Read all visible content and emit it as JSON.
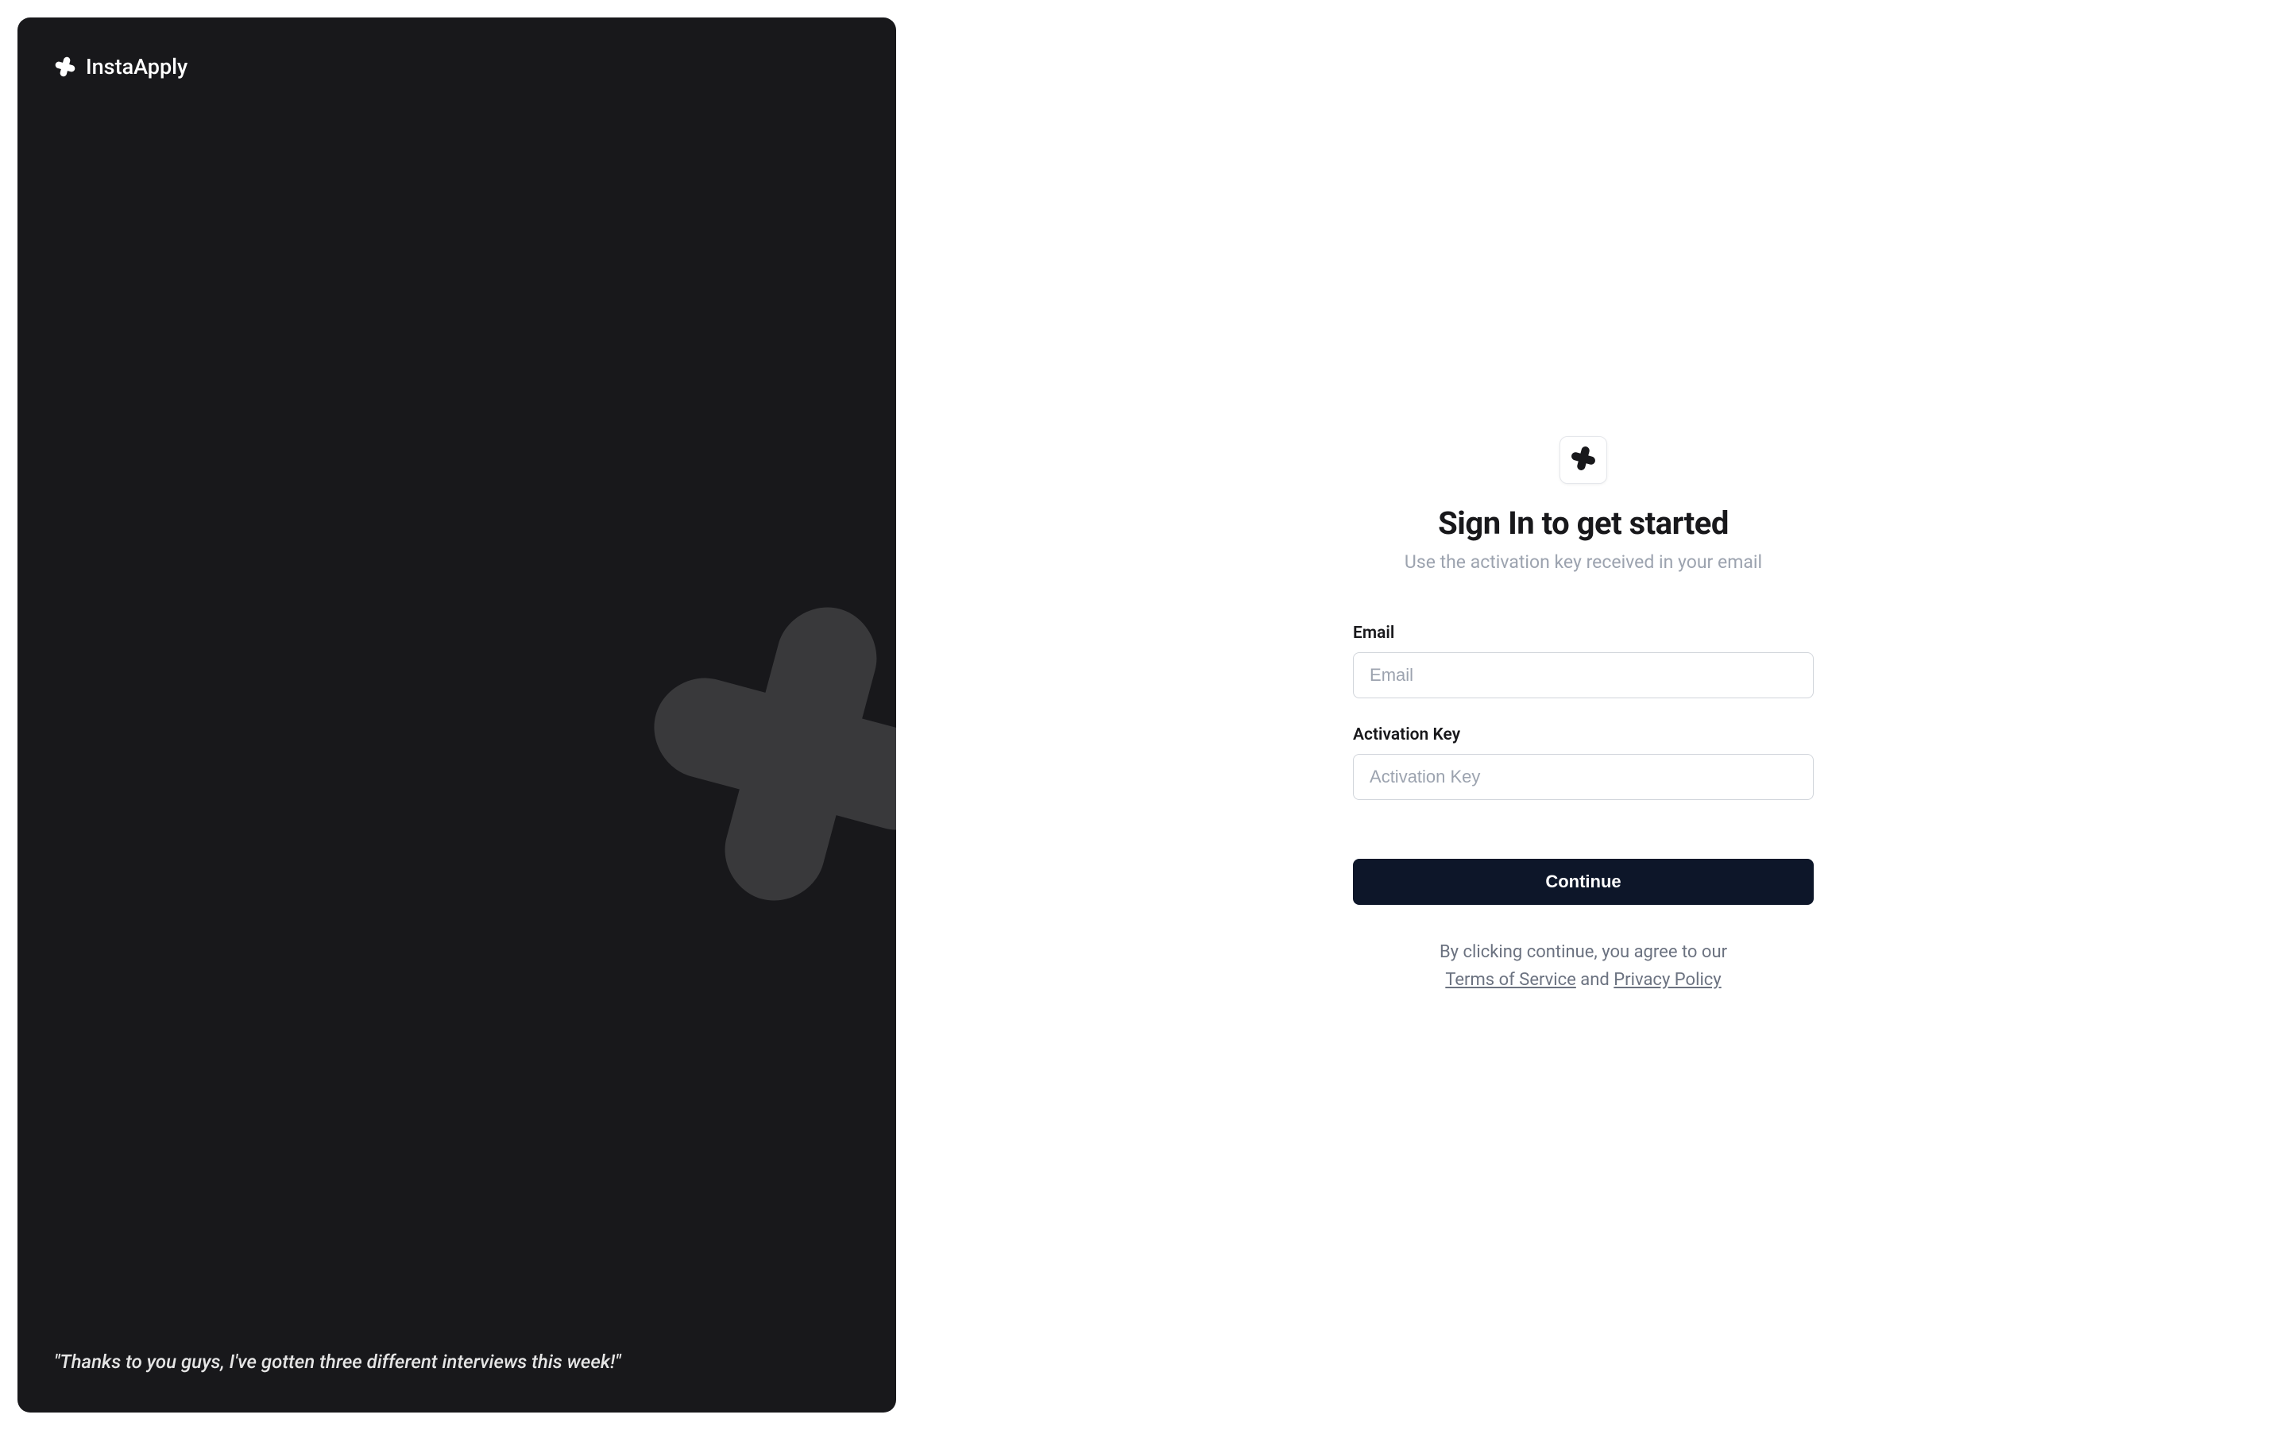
{
  "sidebar": {
    "brand": "InstaApply",
    "quote": "\"Thanks to you guys, I've gotten three different interviews this week!\""
  },
  "signin": {
    "title": "Sign In to get started",
    "subtitle": "Use the activation key received in your email",
    "email_label": "Email",
    "email_placeholder": "Email",
    "key_label": "Activation Key",
    "key_placeholder": "Activation Key",
    "continue_label": "Continue",
    "legal_prefix": "By clicking continue, you agree to our ",
    "terms_label": "Terms of Service",
    "legal_conjunction": " and ",
    "privacy_label": "Privacy Policy"
  }
}
